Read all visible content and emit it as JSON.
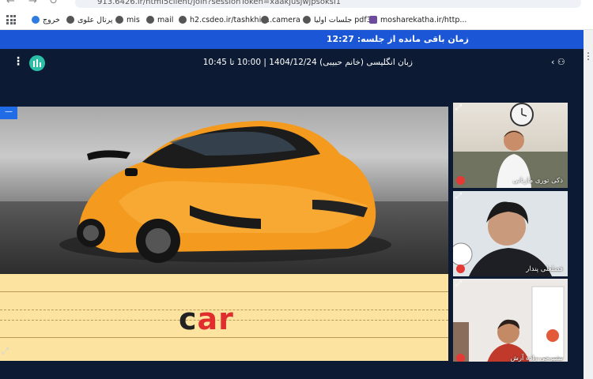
{
  "browser": {
    "url": "913.6426.ir/html5client/join?sessionToken=xaakjusjwjpsoksi1",
    "bookmarks": [
      {
        "label": "خروج",
        "icon": "globe-icon"
      },
      {
        "label": "پرتال علوی",
        "icon": "globe-icon"
      },
      {
        "label": "mis",
        "icon": "globe-icon"
      },
      {
        "label": "mail",
        "icon": "globe-icon"
      },
      {
        "label": "h2.csdeo.ir/tashkhis...",
        "icon": "globe-icon"
      },
      {
        "label": "camera",
        "icon": "globe-icon"
      },
      {
        "label": "جلسات اولیا pdf3",
        "icon": "globe-icon"
      },
      {
        "label": "mosharekatha.ir/http...",
        "icon": "globe-icon"
      }
    ]
  },
  "session": {
    "timer_text": "زمان باقی مانده از جلسه: 12:27",
    "title": "زبان انگلیسی (خانم حبیبی) 1404/12/24 | 10:00 تا 10:45"
  },
  "presentation": {
    "word_first": "c",
    "word_rest": "ar",
    "minimize_label": "—"
  },
  "webcams": [
    {
      "name": "ذکی توری مازنانی"
    },
    {
      "name": "فضلعلی پندار"
    },
    {
      "name": "بشیرجی زاده آرش"
    }
  ],
  "colors": {
    "timer_bar": "#1a56d6",
    "app_bg": "#0c1b33",
    "logo": "#2bbfa8",
    "word_red": "#e02d2d",
    "page_yellow": "#fde3a0"
  }
}
